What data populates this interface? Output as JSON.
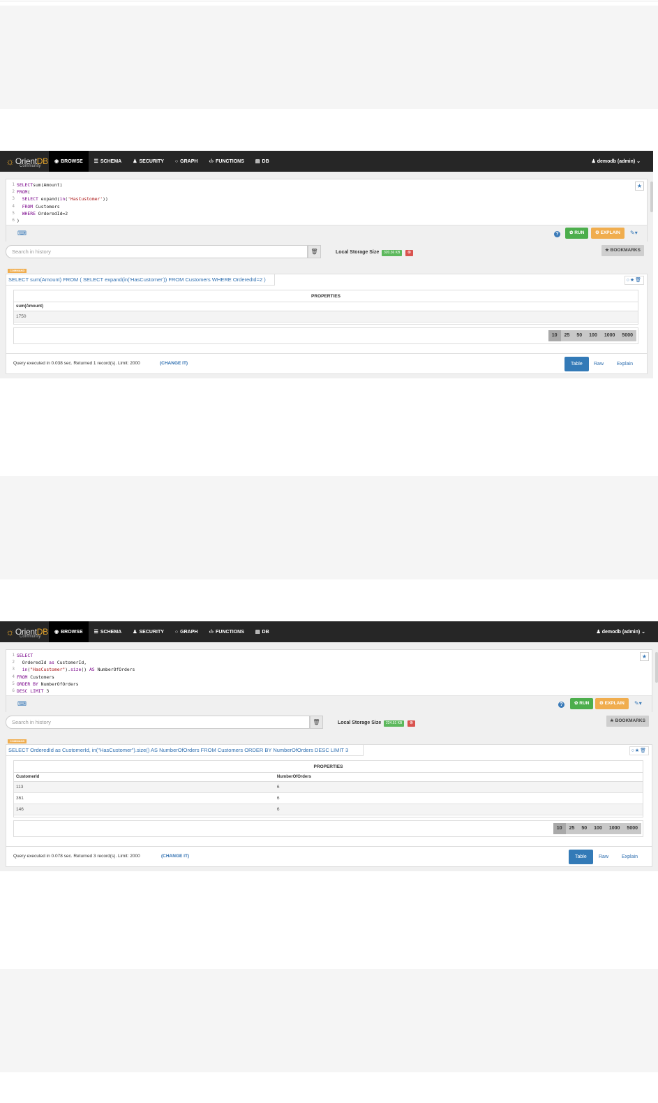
{
  "app": {
    "logo_text_a": "Orient",
    "logo_text_b": "DB",
    "logo_sub": "Community"
  },
  "nav": {
    "items": [
      {
        "icon": "eye-icon",
        "glyph": "◉",
        "label": "BROWSE"
      },
      {
        "icon": "schema-icon",
        "glyph": "☰",
        "label": "SCHEMA"
      },
      {
        "icon": "user-icon",
        "glyph": "♟",
        "label": "SECURITY"
      },
      {
        "icon": "circle-icon",
        "glyph": "○",
        "label": "GRAPH"
      },
      {
        "icon": "code-icon",
        "glyph": "‹/›",
        "label": "FUNCTIONS"
      },
      {
        "icon": "database-icon",
        "glyph": "▤",
        "label": "DB"
      }
    ],
    "user": "♟ demodb (admin) ⌄"
  },
  "panels": [
    {
      "editor_lines": [
        {
          "n": "1",
          "parts": [
            [
              "kw",
              "SELECT"
            ],
            [
              "",
              "sum(Amount)"
            ]
          ]
        },
        {
          "n": "2",
          "parts": [
            [
              "kw",
              "FROM"
            ],
            [
              "",
              "("
            ]
          ]
        },
        {
          "n": "3",
          "parts": [
            [
              "",
              "  "
            ],
            [
              "kw",
              "SELECT"
            ],
            [
              "",
              " expand("
            ],
            [
              "kw",
              "in"
            ],
            [
              "",
              "("
            ],
            [
              "str",
              "'HasCustomer'"
            ],
            [
              "",
              "))"
            ]
          ]
        },
        {
          "n": "4",
          "parts": [
            [
              "",
              "  "
            ],
            [
              "kw",
              "FROM"
            ],
            [
              "",
              " Customers"
            ]
          ]
        },
        {
          "n": "5",
          "parts": [
            [
              "",
              "  "
            ],
            [
              "kw",
              "WHERE"
            ],
            [
              "",
              " OrderedId=2"
            ]
          ]
        },
        {
          "n": "6",
          "parts": [
            [
              "",
              ")"
            ]
          ]
        }
      ],
      "run_label": "✿ RUN",
      "explain_label": "⚙ EXPLAIN",
      "history_placeholder": "Search in history",
      "storage_label": "Local Storage Size",
      "storage_size": "320.36 KB",
      "bookmarks_label": "★ BOOKMARKS",
      "badge": "COMMAND",
      "query": "SELECT sum(Amount) FROM ( SELECT expand(in('HasCustomer')) FROM Customers WHERE OrderedId=2 )",
      "props_title": "PROPERTIES",
      "columns": [
        "sum(Amount)"
      ],
      "rows": [
        [
          "1750"
        ]
      ],
      "pages": [
        "10",
        "25",
        "50",
        "100",
        "1000",
        "5000"
      ],
      "footer": "Query executed in 0.038 sec. Returned 1 record(s). Limit: 2000",
      "change_it": "(CHANGE IT)",
      "tabs": [
        "Table",
        "Raw",
        "Explain"
      ]
    },
    {
      "editor_lines": [
        {
          "n": "1",
          "parts": [
            [
              "kw",
              "SELECT"
            ]
          ]
        },
        {
          "n": "2",
          "parts": [
            [
              "",
              "  OrderedId "
            ],
            [
              "kw",
              "as"
            ],
            [
              "",
              " CustomerId,"
            ]
          ]
        },
        {
          "n": "3",
          "parts": [
            [
              "",
              "  "
            ],
            [
              "kw",
              "in"
            ],
            [
              "",
              "("
            ],
            [
              "str",
              "\"HasCustomer\""
            ],
            [
              "",
              ")."
            ],
            [
              "kw",
              "size"
            ],
            [
              "",
              "() "
            ],
            [
              "kw",
              "AS"
            ],
            [
              "",
              " NumberOfOrders"
            ]
          ]
        },
        {
          "n": "4",
          "parts": [
            [
              "kw",
              "FROM"
            ],
            [
              "",
              " Customers"
            ]
          ]
        },
        {
          "n": "5",
          "parts": [
            [
              "kw",
              "ORDER BY"
            ],
            [
              "",
              " NumberOfOrders"
            ]
          ]
        },
        {
          "n": "6",
          "parts": [
            [
              "kw",
              "DESC LIMIT"
            ],
            [
              "",
              " 3"
            ]
          ]
        }
      ],
      "run_label": "✿ RUN",
      "explain_label": "⚙ EXPLAIN",
      "history_placeholder": "Search in history",
      "storage_label": "Local Storage Size",
      "storage_size": "224.51 KB",
      "bookmarks_label": "★ BOOKMARKS",
      "badge": "COMMAND",
      "query": "SELECT OrderedId as CustomerId, in(\"HasCustomer\").size() AS NumberOfOrders FROM Customers ORDER BY NumberOfOrders DESC LIMIT 3",
      "props_title": "PROPERTIES",
      "columns": [
        "CustomerId",
        "NumberOfOrders"
      ],
      "rows": [
        [
          "113",
          "6"
        ],
        [
          "361",
          "6"
        ],
        [
          "146",
          "6"
        ]
      ],
      "pages": [
        "10",
        "25",
        "50",
        "100",
        "1000",
        "5000"
      ],
      "footer": "Query executed in 0.078 sec. Returned 3 record(s). Limit: 2000",
      "change_it": "(CHANGE IT)",
      "tabs": [
        "Table",
        "Raw",
        "Explain"
      ]
    }
  ]
}
